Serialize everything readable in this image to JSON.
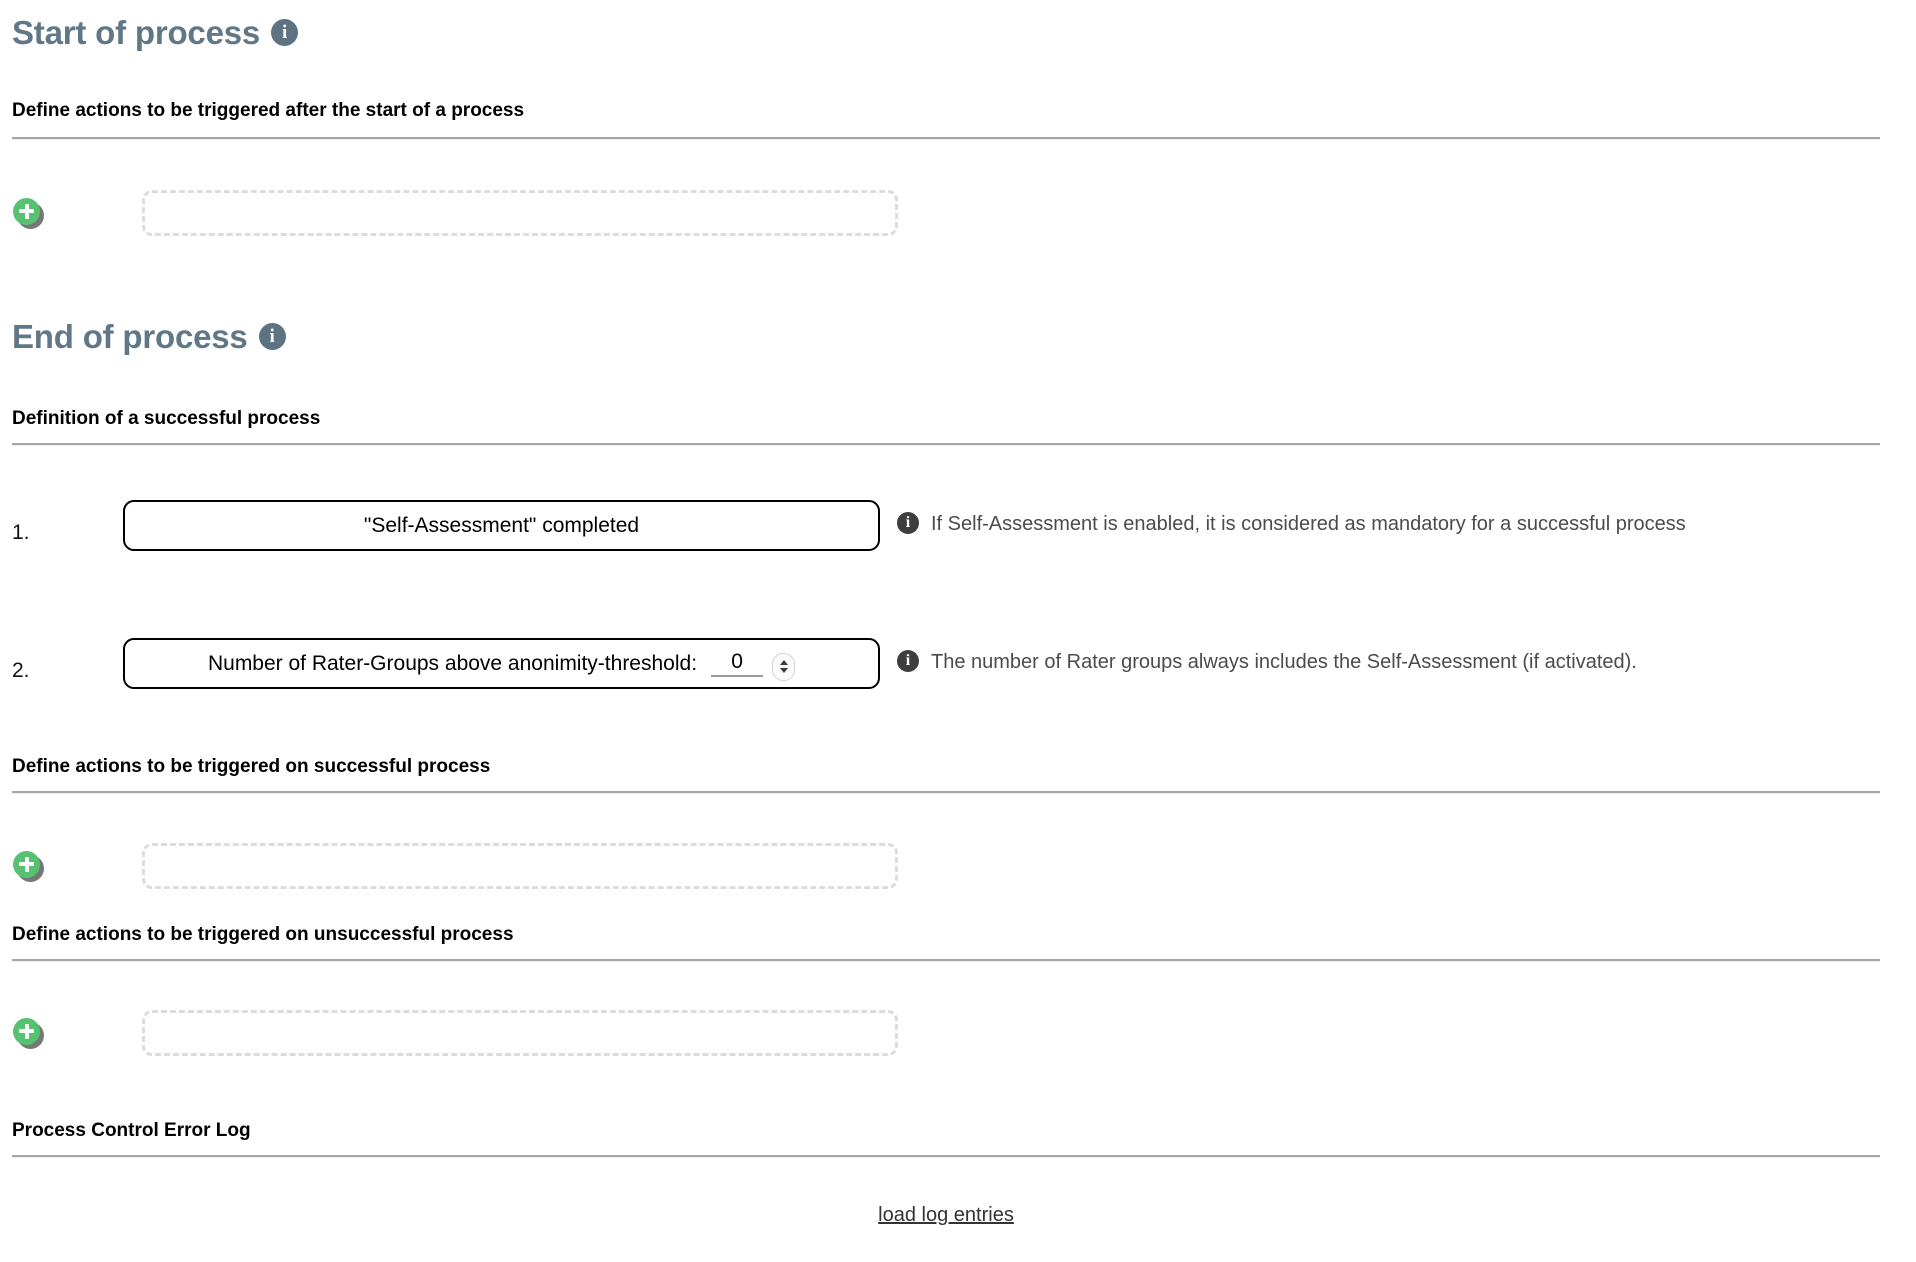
{
  "sections": [
    {
      "id": "start-of-process",
      "title": "Start of process",
      "info_icon": "info-icon",
      "info_glyph": "i",
      "sub_head": "Define actions to be triggered after the start of a process",
      "add_button_label": "add-action",
      "drop_zone_label": ""
    },
    {
      "id": "end-of-process",
      "title": "End of process",
      "info_icon": "info-icon",
      "info_glyph": "i",
      "sub_head": "Definition of a successful process"
    }
  ],
  "criteria": [
    {
      "number": "1.",
      "label": "\"Self-Assessment\" completed",
      "hint": "If Self-Assessment is enabled, it is considered as mandatory for a successful process",
      "hint_icon": "info-icon",
      "hint_glyph": "i"
    },
    {
      "number": "2.",
      "label": "Number of Rater-Groups above anonimity-threshold:",
      "value": "0",
      "spinner_up": "chevron-up-icon",
      "spinner_down": "chevron-down-icon",
      "hint": "The number of Rater groups always includes the Self-Assessment (if activated).",
      "hint_icon": "info-icon",
      "hint_glyph": "i"
    }
  ],
  "action_blocks": [
    {
      "id": "successful-process-actions",
      "sub_head": "Define actions to be triggered on successful process",
      "add_button_label": "add-action"
    },
    {
      "id": "unsuccessful-process-actions",
      "sub_head": "Define actions to be triggered on unsuccessful process",
      "add_button_label": "add-action"
    }
  ],
  "error_log": {
    "sub_head": "Process Control Error Log",
    "load_link": "load log entries"
  },
  "colors": {
    "heading": "#607787",
    "info_icon_large": "#5d7382",
    "info_icon_small": "#3e3e3e",
    "add_button": "#56c271",
    "rule": "#a6a6a6",
    "drop_zone_border": "#dcdcdc"
  }
}
